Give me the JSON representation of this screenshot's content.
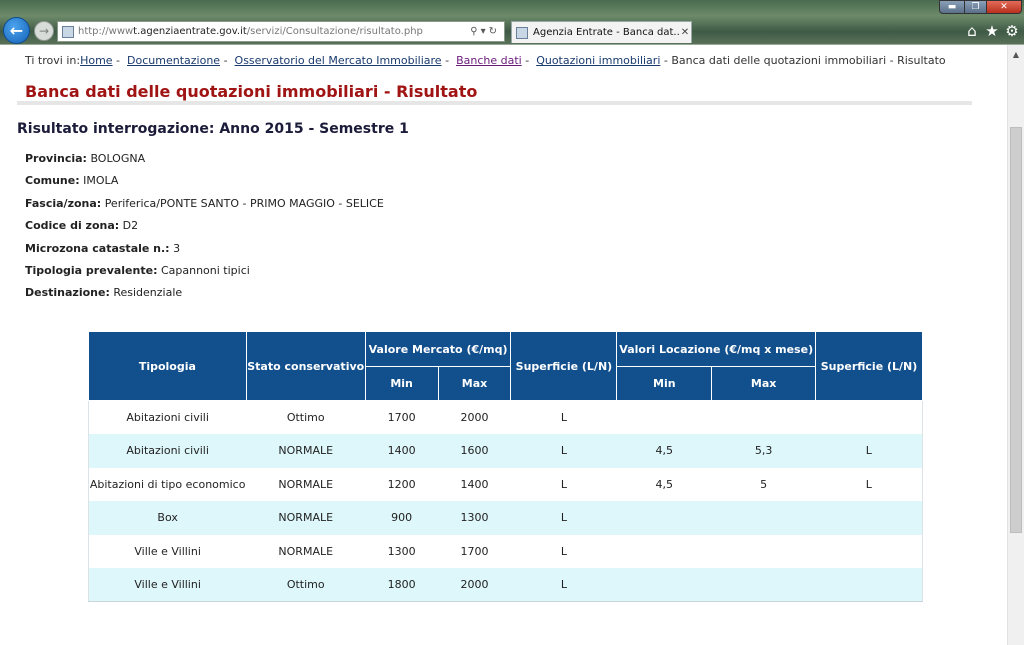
{
  "browser": {
    "url_prefix": "http://www",
    "url_domain": "t.agenziaentrate.gov.it",
    "url_path": "/servizi/Consultazione/risultato.php",
    "tab_title": "Agenzia Entrate - Banca dat...",
    "accent_color": "#1763b6"
  },
  "breadcrumb": {
    "prefix": "Ti trovi in:",
    "items": [
      "Home",
      "Documentazione",
      "Osservatorio del Mercato Immobiliare",
      "Banche dati",
      "Quotazioni immobiliari"
    ],
    "current": "Banca dati delle quotazioni immobiliari - Risultato"
  },
  "page": {
    "title": "Banca dati delle quotazioni immobiliari - Risultato",
    "title_color": "#a01414",
    "result_heading": "Risultato interrogazione: Anno 2015 - Semestre 1"
  },
  "details": [
    {
      "label": "Provincia:",
      "value": "BOLOGNA"
    },
    {
      "label": "Comune:",
      "value": "IMOLA"
    },
    {
      "label": "Fascia/zona:",
      "value": "Periferica/PONTE SANTO - PRIMO MAGGIO - SELICE"
    },
    {
      "label": "Codice di zona:",
      "value": "D2"
    },
    {
      "label": "Microzona catastale n.:",
      "value": "3"
    },
    {
      "label": "Tipologia prevalente:",
      "value": "Capannoni tipici"
    },
    {
      "label": "Destinazione:",
      "value": "Residenziale"
    }
  ],
  "table": {
    "header_color": "#114f8d",
    "headers": {
      "tipologia": "Tipologia",
      "stato": "Stato conservativo",
      "valore_mercato": "Valore Mercato (€/mq)",
      "superficie1": "Superficie (L/N)",
      "valori_locazione": "Valori Locazione (€/mq x mese)",
      "superficie2": "Superficie (L/N)",
      "min": "Min",
      "max": "Max"
    },
    "rows": [
      {
        "tipologia": "Abitazioni civili",
        "stato": "Ottimo",
        "vm_min": "1700",
        "vm_max": "2000",
        "sup1": "L",
        "vl_min": "",
        "vl_max": "",
        "sup2": ""
      },
      {
        "tipologia": "Abitazioni civili",
        "stato": "NORMALE",
        "vm_min": "1400",
        "vm_max": "1600",
        "sup1": "L",
        "vl_min": "4,5",
        "vl_max": "5,3",
        "sup2": "L"
      },
      {
        "tipologia": "Abitazioni di tipo economico",
        "stato": "NORMALE",
        "vm_min": "1200",
        "vm_max": "1400",
        "sup1": "L",
        "vl_min": "4,5",
        "vl_max": "5",
        "sup2": "L"
      },
      {
        "tipologia": "Box",
        "stato": "NORMALE",
        "vm_min": "900",
        "vm_max": "1300",
        "sup1": "L",
        "vl_min": "",
        "vl_max": "",
        "sup2": ""
      },
      {
        "tipologia": "Ville e Villini",
        "stato": "NORMALE",
        "vm_min": "1300",
        "vm_max": "1700",
        "sup1": "L",
        "vl_min": "",
        "vl_max": "",
        "sup2": ""
      },
      {
        "tipologia": "Ville e Villini",
        "stato": "Ottimo",
        "vm_min": "1800",
        "vm_max": "2000",
        "sup1": "L",
        "vl_min": "",
        "vl_max": "",
        "sup2": ""
      }
    ]
  }
}
